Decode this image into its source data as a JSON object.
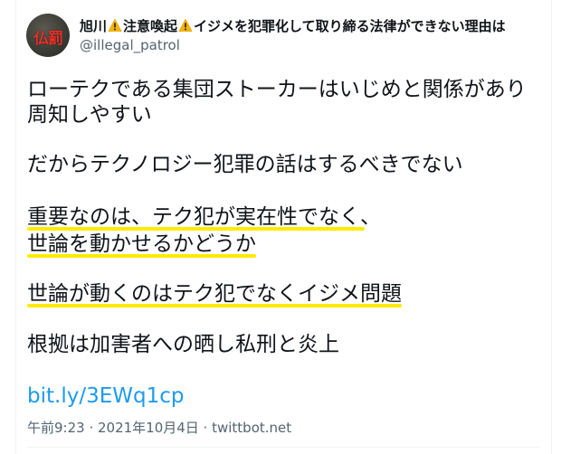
{
  "tweet": {
    "avatar_text": "仏罰",
    "display_name": {
      "part1": "旭川",
      "part2": "注意喚起",
      "part3": "イジメを犯罪化して取り締る法律ができない理由は"
    },
    "handle": "@illegal_patrol",
    "lines": {
      "l1": "ローテクである集団ストーカーはいじめと関係があり",
      "l2": "周知しやすい",
      "l3": "だからテクノロジー犯罪の話はするべきでない",
      "l4": "重要なのは、テク犯が実在性でなく、",
      "l5": "世論を動かせるかどうか",
      "l6": "世論が動くのはテク犯でなくイジメ問題",
      "l7": "根拠は加害者への晒し私刑と炎上"
    },
    "link": "bit.ly/3EWq1cp",
    "meta": "午前9:23 · 2021年10月4日 · twittbot.net"
  },
  "colors": {
    "text": "#0f1419",
    "secondary": "#536471",
    "link": "#1d9bf0",
    "highlight": "#ffeb00",
    "warning": "#f4b400"
  },
  "icons": {
    "warning": "warning-icon"
  }
}
